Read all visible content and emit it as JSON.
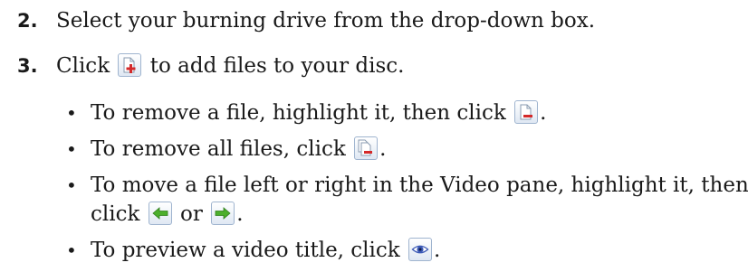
{
  "steps": [
    {
      "number": "2.",
      "text": "Select your burning drive from the drop-down box."
    },
    {
      "number": "3.",
      "before": "Click",
      "after": "to add files to your disc.",
      "icon": "add-file-icon"
    }
  ],
  "bullets": [
    {
      "bullet": "•",
      "before": "To remove a file, highlight it, then click",
      "after": ".",
      "icon": "remove-file-icon"
    },
    {
      "bullet": "•",
      "before": "To remove all files, click",
      "after": ".",
      "icon": "remove-all-files-icon"
    },
    {
      "bullet": "•",
      "line1": "To move a file left or right in the Video pane, highlight it, then",
      "line2_before": "click",
      "line2_middle": "or",
      "line2_after": ".",
      "icons": [
        "move-left-icon",
        "move-right-icon"
      ]
    },
    {
      "bullet": "•",
      "before": "To preview a video title, click",
      "after": ".",
      "icon": "preview-eye-icon"
    }
  ],
  "colors": {
    "text": "#1a1a1a",
    "add_plus": "#d42a2a",
    "remove_minus": "#d42a2a",
    "arrow_green": "#4caf2c",
    "eye_blue": "#3b59b6",
    "icon_border": "#9fb4cf"
  }
}
